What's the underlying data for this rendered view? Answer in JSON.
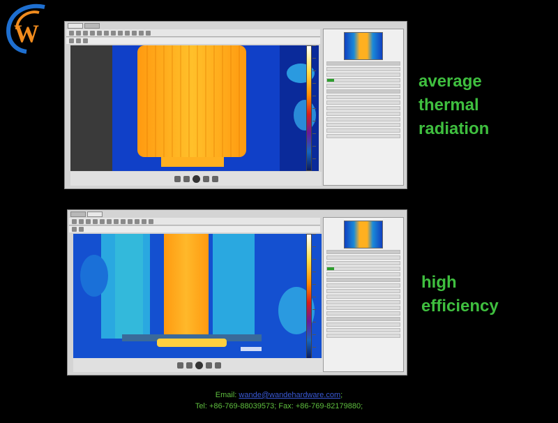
{
  "captions": {
    "top": [
      "average",
      "thermal",
      "radiation"
    ],
    "bottom": [
      "high",
      "efficiency"
    ]
  },
  "contact": {
    "email_label": "Email:",
    "email": "wande@wandehardware.com",
    "email_suffix": ";",
    "phone_line": "Tel: +86-769-88039573; Fax: +86-769-82179880;"
  },
  "colors": {
    "caption": "#3fbf3f",
    "link": "#3a5ad8",
    "thermal_hot": "#ffb020",
    "thermal_cold": "#0a2a9a"
  },
  "icons": [
    "logo-w-icon",
    "play-icon",
    "prev-icon",
    "next-icon",
    "toolbar-tool-icon"
  ]
}
